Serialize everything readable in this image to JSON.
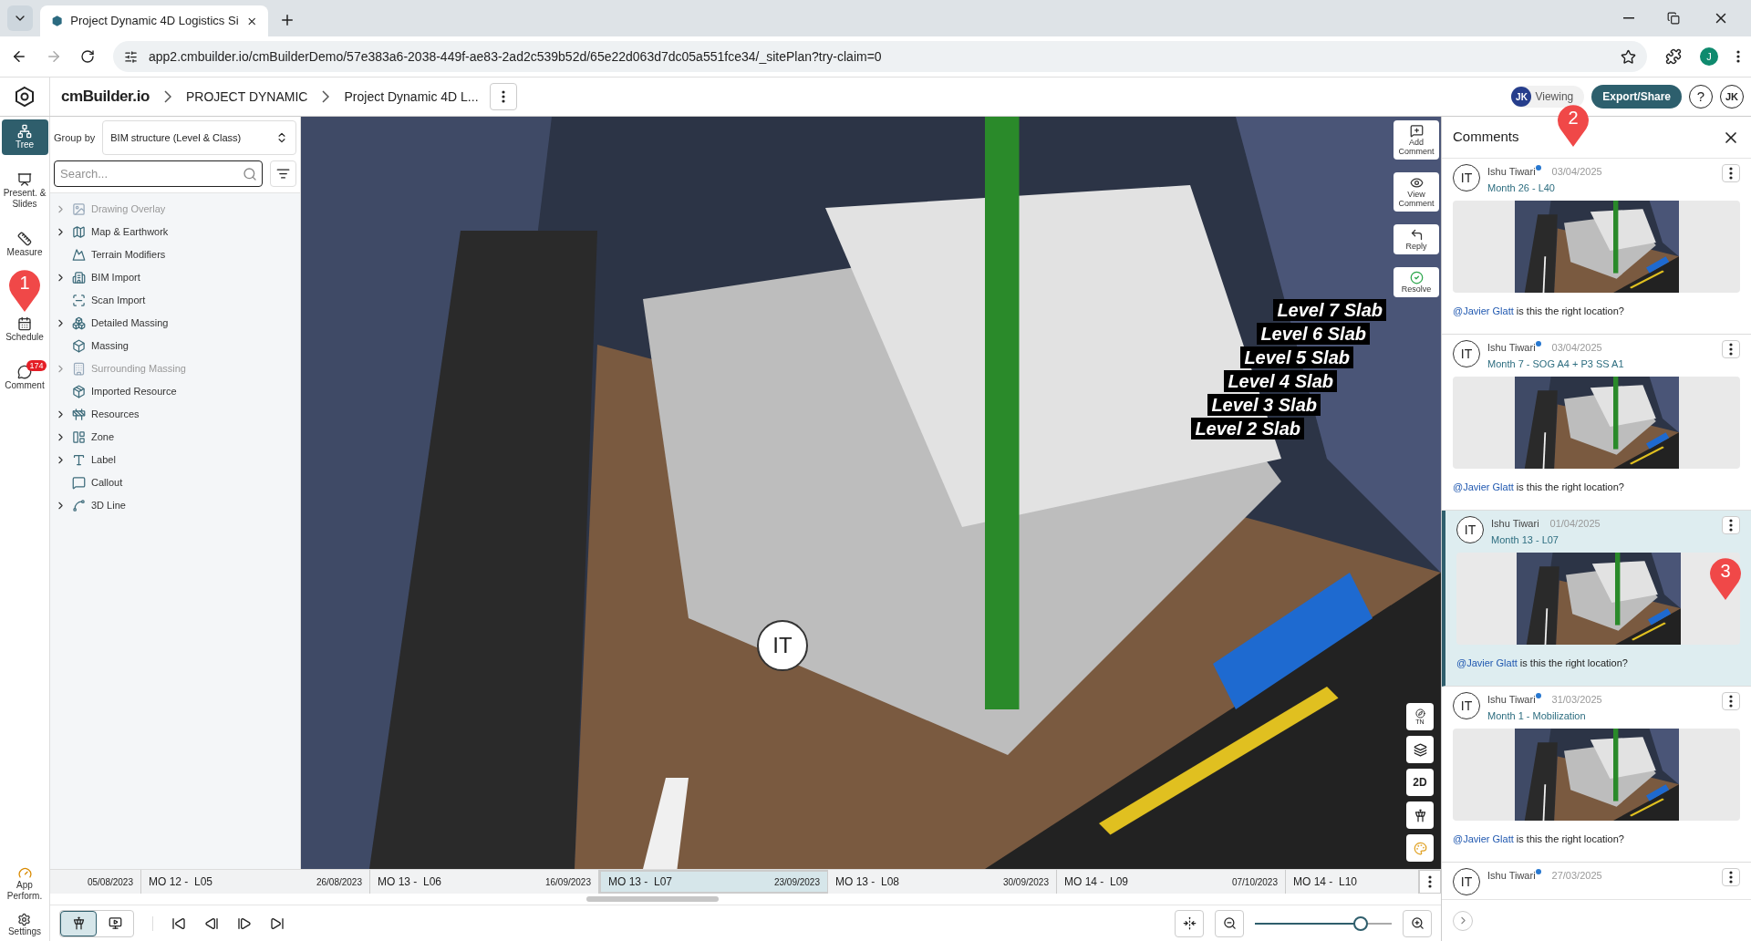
{
  "browser": {
    "tab_title": "Project Dynamic 4D Logistics Si",
    "url": "app2.cmbuilder.io/cmBuilderDemo/57e383a6-2038-449f-ae83-2ad2c539b52d/65e22d063d7dc05a551fce34/_sitePlan?try-claim=0",
    "profile": "J"
  },
  "header": {
    "brand": "cmBuilder.io",
    "breadcrumbs": [
      "PROJECT DYNAMIC",
      "Project Dynamic 4D L..."
    ],
    "viewer_initials": "JK",
    "viewer_label": "Viewing",
    "export_button": "Export/Share",
    "help": "?",
    "user_initials": "JK"
  },
  "rail": {
    "items": [
      {
        "label": "Tree",
        "selected": true
      },
      {
        "label": "Present. & Slides",
        "selected": false
      },
      {
        "label": "Measure",
        "selected": false
      },
      {
        "label": "Schedule",
        "selected": false
      },
      {
        "label": "Comment",
        "selected": false,
        "badge": "174"
      }
    ],
    "bottom_items": [
      "App Perform.",
      "Settings"
    ]
  },
  "tree": {
    "group_by_label": "Group by",
    "group_by_value": "BIM structure (Level & Class)",
    "search_placeholder": "Search...",
    "items": [
      {
        "label": "Drawing Overlay",
        "expandable": true,
        "disabled": true
      },
      {
        "label": "Map & Earthwork",
        "expandable": true,
        "disabled": false
      },
      {
        "label": "Terrain Modifiers",
        "expandable": false,
        "disabled": false
      },
      {
        "label": "BIM Import",
        "expandable": true,
        "disabled": false
      },
      {
        "label": "Scan Import",
        "expandable": false,
        "disabled": false
      },
      {
        "label": "Detailed Massing",
        "expandable": true,
        "disabled": false
      },
      {
        "label": "Massing",
        "expandable": false,
        "disabled": false
      },
      {
        "label": "Surrounding Massing",
        "expandable": true,
        "disabled": true
      },
      {
        "label": "Imported Resource",
        "expandable": false,
        "disabled": false
      },
      {
        "label": "Resources",
        "expandable": true,
        "disabled": false
      },
      {
        "label": "Zone",
        "expandable": true,
        "disabled": false
      },
      {
        "label": "Label",
        "expandable": true,
        "disabled": false
      },
      {
        "label": "Callout",
        "expandable": false,
        "disabled": false
      },
      {
        "label": "3D Line",
        "expandable": true,
        "disabled": false
      }
    ]
  },
  "viewport": {
    "toolbar": [
      "Add Comment",
      "View Comment",
      "Reply",
      "Resolve"
    ],
    "slab_labels": [
      "Level 7 Slab",
      "Level 6 Slab",
      "Level 5 Slab",
      "Level 4 Slab",
      "Level 3 Slab",
      "Level 2 Slab"
    ],
    "comment_marker": "IT",
    "compass": "TN",
    "view_mode": "2D"
  },
  "timeline": {
    "segments": [
      {
        "date": "05/08/2023",
        "selected": false
      },
      {
        "label": "MO 12 -  L05",
        "date": "26/08/2023",
        "selected": false
      },
      {
        "label": "MO 13 -  L06",
        "date": "16/09/2023",
        "selected": false
      },
      {
        "label": "MO 13 -  L07",
        "date": "23/09/2023",
        "selected": true
      },
      {
        "label": "MO 13 -  L08",
        "date": "30/09/2023",
        "selected": false
      },
      {
        "label": "MO 14 -  L09",
        "date": "07/10/2023",
        "selected": false
      },
      {
        "label": "MO 14 -  L10",
        "selected": false
      }
    ],
    "zoom": {
      "level": 0.77
    },
    "mode_toggle": [
      {
        "selected": true
      },
      {
        "selected": false
      }
    ]
  },
  "comments": {
    "title": "Comments",
    "items": [
      {
        "initials": "IT",
        "author": "Ishu Tiwari",
        "online": true,
        "date": "03/04/2025",
        "phase": "Month 26 - L40",
        "mention": "@Javier Glatt",
        "text": "is this the right location?",
        "selected": false
      },
      {
        "initials": "IT",
        "author": "Ishu Tiwari",
        "online": true,
        "date": "03/04/2025",
        "phase": "Month 7 - SOG A4 + P3 SS A1",
        "mention": "@Javier Glatt",
        "text": "is this the right location?",
        "selected": false
      },
      {
        "initials": "IT",
        "author": "Ishu Tiwari",
        "online": false,
        "date": "01/04/2025",
        "phase": "Month 13 - L07",
        "mention": "@Javier Glatt",
        "text": "is this the right location?",
        "selected": true
      },
      {
        "initials": "IT",
        "author": "Ishu Tiwari",
        "online": true,
        "date": "31/03/2025",
        "phase": "Month 1 - Mobilization",
        "mention": "@Javier Glatt",
        "text": "is this the right location?",
        "selected": false
      },
      {
        "initials": "IT",
        "author": "Ishu Tiwari",
        "online": true,
        "date": "27/03/2025",
        "selected": false
      }
    ]
  },
  "annotations": [
    "1",
    "2",
    "3"
  ]
}
